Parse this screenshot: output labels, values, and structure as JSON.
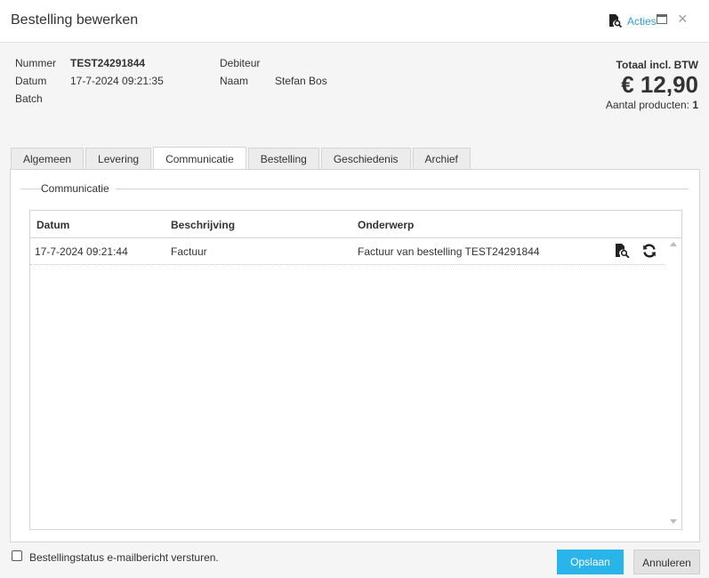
{
  "window": {
    "title": "Bestelling bewerken",
    "actions_label": "Acties",
    "close_glyph": "×"
  },
  "order": {
    "number_label": "Nummer",
    "number_value": "TEST24291844",
    "date_label": "Datum",
    "date_value": "17-7-2024 09:21:35",
    "batch_label": "Batch",
    "debtor_label": "Debiteur",
    "name_label": "Naam",
    "name_value": "Stefan Bos"
  },
  "totals": {
    "label": "Totaal incl. BTW",
    "amount": "€ 12,90",
    "count_label": "Aantal producten:",
    "count_value": "1"
  },
  "tabs": [
    {
      "label": "Algemeen",
      "active": false
    },
    {
      "label": "Levering",
      "active": false
    },
    {
      "label": "Communicatie",
      "active": true
    },
    {
      "label": "Bestelling",
      "active": false
    },
    {
      "label": "Geschiedenis",
      "active": false
    },
    {
      "label": "Archief",
      "active": false
    }
  ],
  "communication": {
    "legend": "Communicatie",
    "columns": [
      "Datum",
      "Beschrijving",
      "Onderwerp"
    ],
    "rows": [
      {
        "date": "17-7-2024 09:21:44",
        "description": "Factuur",
        "subject": "Factuur van bestelling TEST24291844",
        "icons": [
          "document-search-icon",
          "refresh-icon"
        ]
      }
    ]
  },
  "footer": {
    "checkbox_label": "Bestellingstatus e-mailbericht versturen.",
    "checkbox_checked": false,
    "save_label": "Opslaan",
    "cancel_label": "Annuleren"
  },
  "colors": {
    "accent": "#2ab5ea",
    "link": "#2a9fd6"
  },
  "icons": {
    "actions": "document-search-icon",
    "maximize": "maximize-icon",
    "close": "close-icon"
  }
}
